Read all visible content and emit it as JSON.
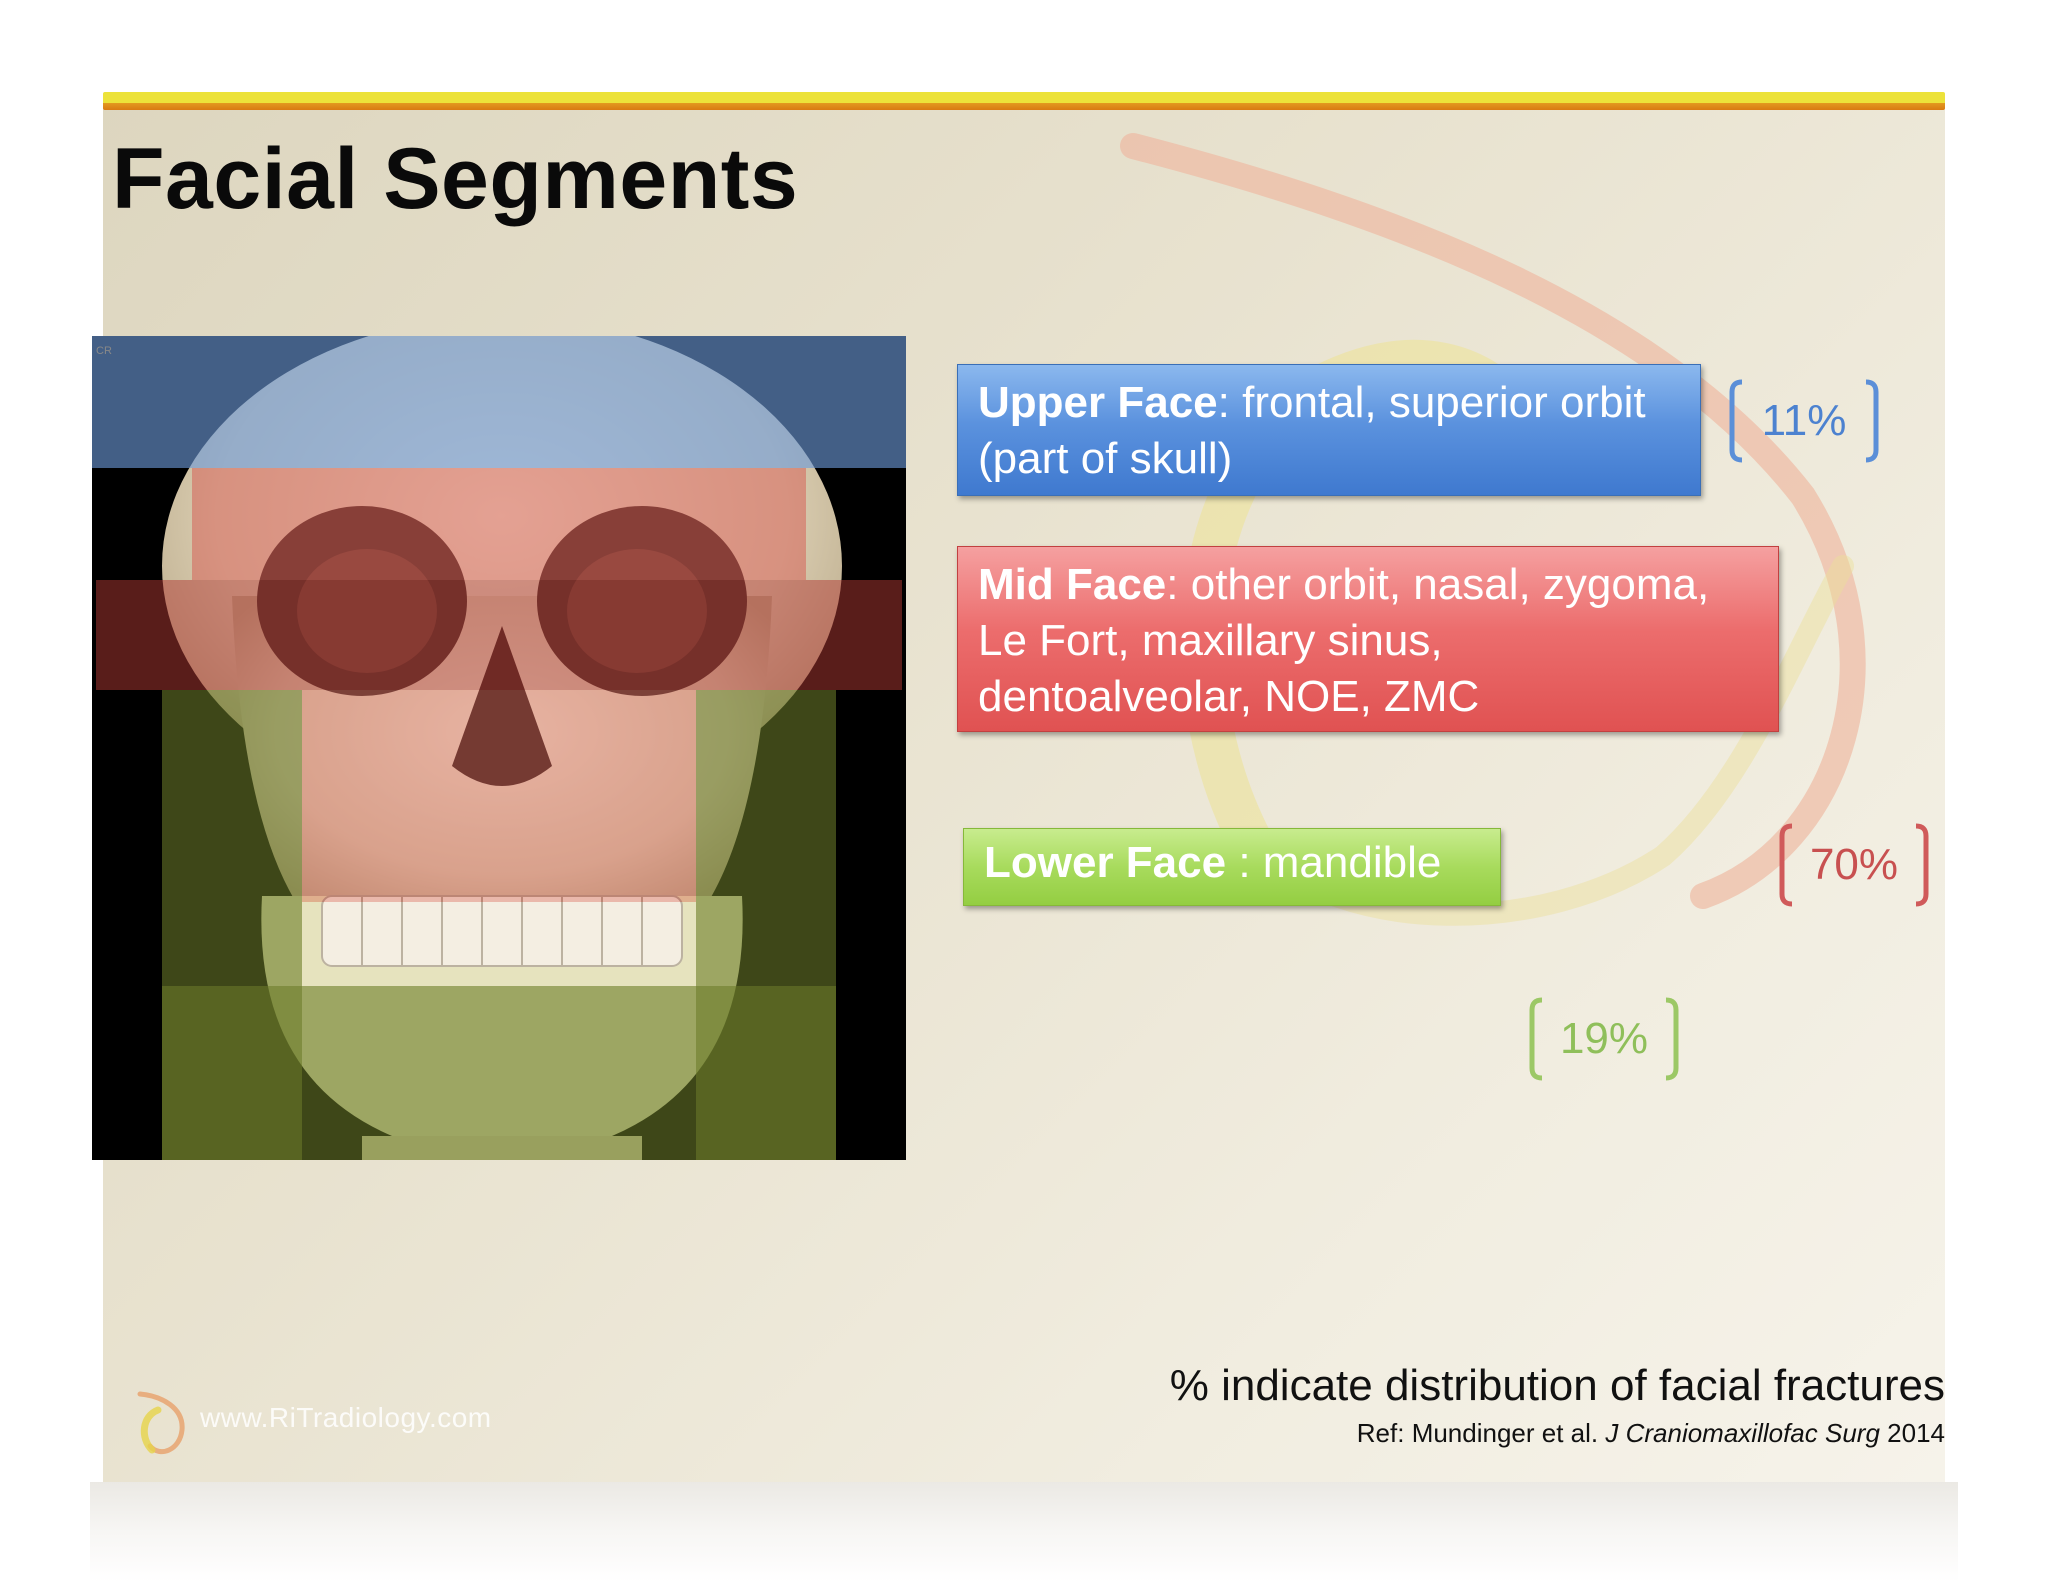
{
  "slide": {
    "title": "Facial Segments",
    "upper": {
      "bold": "Upper Face",
      "rest": ": frontal, superior orbit",
      "line2": "(part of skull)",
      "percent": "11%",
      "color": "#4a84d6"
    },
    "mid": {
      "bold": "Mid Face",
      "rest": ": other orbit, nasal, zygoma,",
      "line2": "Le Fort, maxillary sinus,",
      "line3": "dentoalveolar, NOE, ZMC",
      "percent": "70%",
      "color": "#e35a5a"
    },
    "lower": {
      "bold": "Lower Face ",
      "rest": ": mandible",
      "percent": "19%",
      "color": "#9bd24c"
    },
    "footnote": {
      "main": "% indicate distribution of facial fractures",
      "ref_prefix": "Ref: Mundinger et al. ",
      "ref_journal": "J Craniomaxillofac Surg",
      "ref_year": " 2014"
    },
    "watermark": "www.RiTradiology.com"
  }
}
